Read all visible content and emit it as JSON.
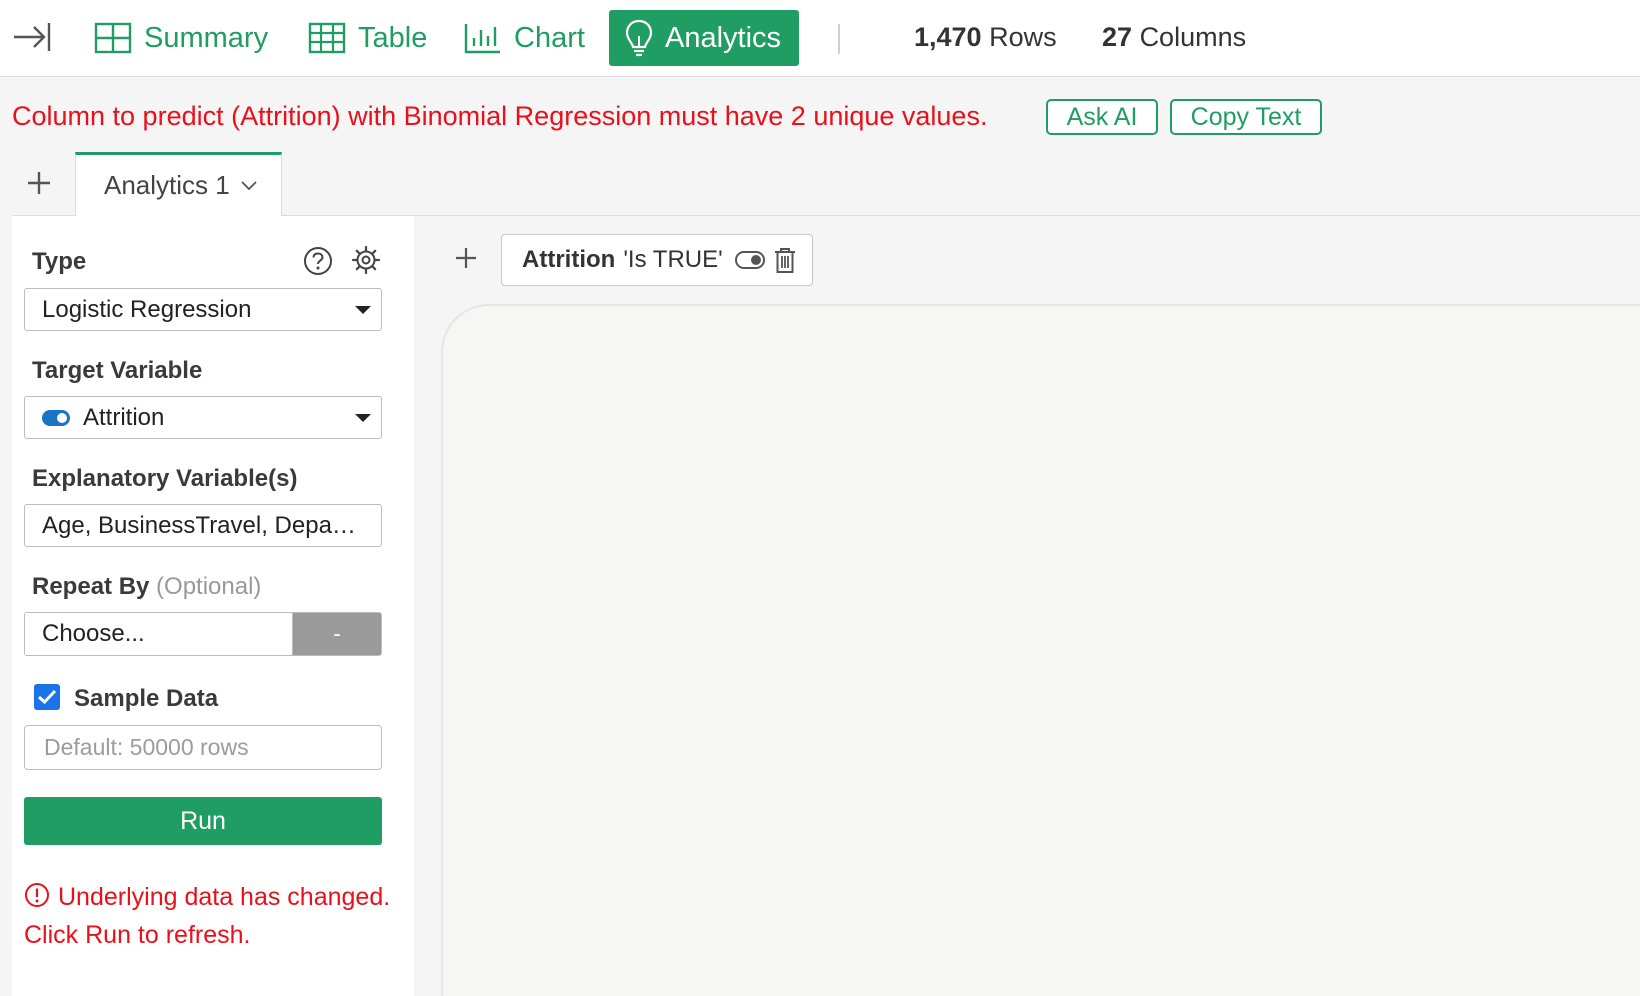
{
  "nav": {
    "tabs": [
      {
        "label": "Summary",
        "icon": "summary-icon"
      },
      {
        "label": "Table",
        "icon": "table-icon"
      },
      {
        "label": "Chart",
        "icon": "chart-icon"
      },
      {
        "label": "Analytics",
        "icon": "lightbulb-icon",
        "active": true
      }
    ],
    "rows_count": "1,470",
    "rows_label": "Rows",
    "columns_count": "27",
    "columns_label": "Columns"
  },
  "error": {
    "message": "Column to predict (Attrition) with Binomial Regression must have 2 unique values.",
    "ask_ai_label": "Ask AI",
    "copy_text_label": "Copy Text"
  },
  "analytics_tab": {
    "label": "Analytics 1"
  },
  "panel": {
    "type_label": "Type",
    "type_value": "Logistic Regression",
    "target_label": "Target Variable",
    "target_value": "Attrition",
    "explanatory_label": "Explanatory Variable(s)",
    "explanatory_value": "Age, BusinessTravel, Department, DistanceFromHome, Education",
    "repeat_label": "Repeat By",
    "repeat_optional": "(Optional)",
    "repeat_value": "Choose...",
    "repeat_button": "-",
    "sample_label": "Sample Data",
    "sample_checked": true,
    "sample_placeholder": "Default: 50000 rows",
    "run_label": "Run",
    "warning": "Underlying data has changed. Click Run to refresh."
  },
  "filter": {
    "column": "Attrition",
    "condition": "'Is TRUE'"
  },
  "colors": {
    "accent": "#1f9d63",
    "error": "#e8101a",
    "toggle": "#1a73c8"
  }
}
